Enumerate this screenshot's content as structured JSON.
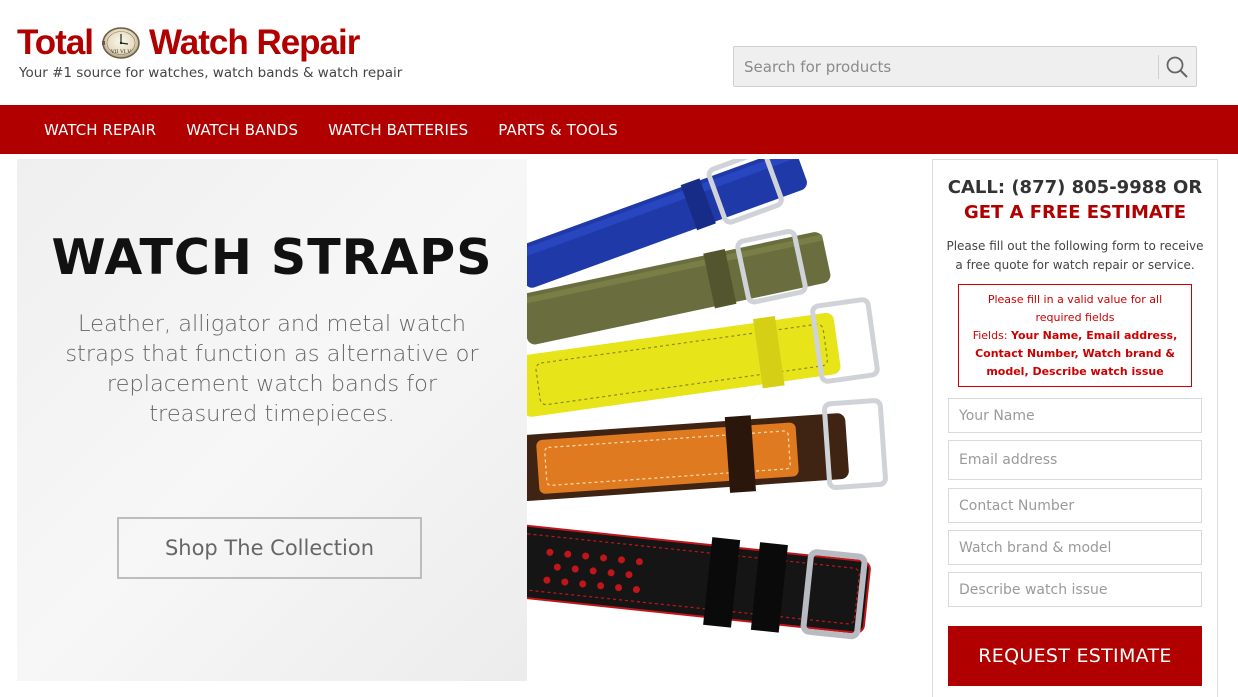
{
  "brand": {
    "logo_word_left": "Total",
    "logo_word_right": "Watch Repair",
    "tagline": "Your #1 source for watches, watch bands & watch repair",
    "color": "#b00000"
  },
  "search": {
    "placeholder": "Search for products",
    "icon": "search-icon"
  },
  "nav": {
    "items": [
      {
        "label": "WATCH REPAIR"
      },
      {
        "label": "WATCH BANDS"
      },
      {
        "label": "WATCH BATTERIES"
      },
      {
        "label": "PARTS & TOOLS"
      }
    ]
  },
  "hero": {
    "title": "WATCH STRAPS",
    "description": "Leather, alligator and metal watch straps that function as alternative or replacement watch bands for treasured timepieces.",
    "button_label": "Shop The Collection",
    "image_alt": "watch-straps-image"
  },
  "estimate": {
    "call_line": "CALL: (877) 805-9988 OR",
    "headline": "GET A FREE ESTIMATE",
    "intro": "Please fill out the following form to receive a free quote for watch repair or service.",
    "error_text": "Please fill in a valid value for all required fields",
    "error_fields_label": "Fields:",
    "error_fields_list": "Your Name, Email address, Contact Number, Watch brand & model, Describe watch issue",
    "fields": {
      "name": "Your Name",
      "email": "Email address",
      "phone": "Contact Number",
      "brand": "Watch brand & model",
      "issue": "Describe watch issue"
    },
    "submit_label": "REQUEST ESTIMATE"
  }
}
